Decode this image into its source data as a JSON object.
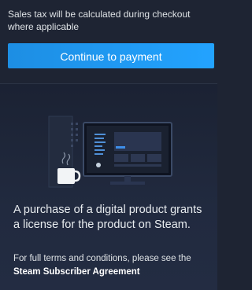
{
  "checkout": {
    "tax_note": "Sales tax will be calculated during checkout where applicable",
    "continue_label": "Continue to payment"
  },
  "license": {
    "statement": "A purchase of a digital product grants a license for the product on Steam.",
    "terms_prefix": "For full terms and conditions, please see the ",
    "terms_link": "Steam Subscriber Agreement"
  },
  "colors": {
    "background": "#1e2433",
    "button": "#1a9fff",
    "accent": "#3d8be0"
  },
  "illustration": {
    "icon": "desktop-computer-with-coffee-mug-illustration"
  }
}
